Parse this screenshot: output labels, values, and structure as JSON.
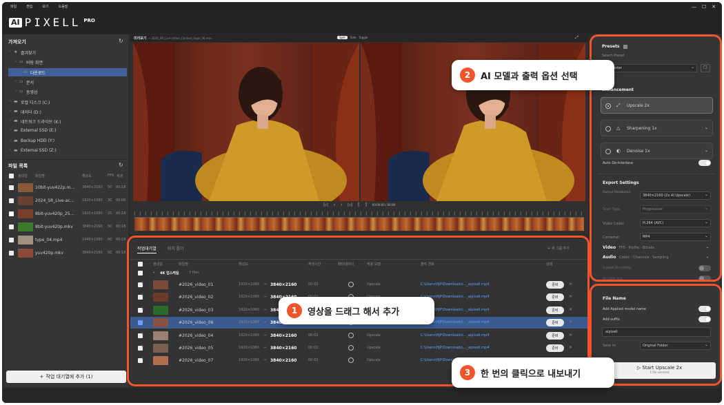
{
  "app": {
    "logo_text": "PIXELL",
    "logo_sub": "PRO",
    "menu": [
      "파일",
      "편집",
      "보기",
      "도움말"
    ]
  },
  "window_controls": [
    "—",
    "☐",
    "✕"
  ],
  "import_panel": {
    "title": "가져오기",
    "tree": [
      {
        "label": "즐겨찾기",
        "level": 0,
        "icon": "star-icon"
      },
      {
        "label": "바탕 화면",
        "level": 1,
        "icon": "folder-icon"
      },
      {
        "label": "다운로드",
        "level": 1,
        "icon": "folder-icon",
        "selected": true
      },
      {
        "label": "문서",
        "level": 1,
        "icon": "folder-icon"
      },
      {
        "label": "동영상",
        "level": 1,
        "icon": "folder-icon"
      },
      {
        "label": "로컬 디스크 (C:)",
        "level": 0,
        "icon": "drive-icon"
      },
      {
        "label": "데이터 (D:)",
        "level": 0,
        "icon": "drive-icon"
      },
      {
        "label": "네트워크 드라이브 (K:)",
        "level": 0,
        "icon": "drive-icon"
      },
      {
        "label": "External SSD (E:)",
        "level": 0,
        "icon": "drive-icon"
      },
      {
        "label": "Backup HDD (Y:)",
        "level": 0,
        "icon": "drive-icon"
      },
      {
        "label": "External SSD (Z:)",
        "level": 0,
        "icon": "drive-icon"
      }
    ]
  },
  "file_list": {
    "title": "파일 목록",
    "columns": [
      "썸네일",
      "파일명",
      "해상도",
      "FPS",
      "재생"
    ],
    "files": [
      {
        "name": "10bit-yuv422p.m...",
        "res": "3840×2160",
        "fps": "50",
        "dur": "00:18",
        "thumb": "#8a5a3a"
      },
      {
        "name": "2024_SR_Live-ac...",
        "res": "1920×1080",
        "fps": "30",
        "dur": "00:00",
        "thumb": "#6a4030"
      },
      {
        "name": "8bit-yuv420p_25...",
        "res": "1920×1080",
        "fps": "25",
        "dur": "00:18",
        "thumb": "#7a3f2a"
      },
      {
        "name": "8bit-yuv420p.mkv",
        "res": "3840×2160",
        "fps": "50",
        "dur": "00:18",
        "thumb": "#3a7a2a"
      },
      {
        "name": "type_04.mp4",
        "res": "1440×1080",
        "fps": "60",
        "dur": "00:18",
        "thumb": "#a09080"
      },
      {
        "name": "yuv420p.mkv",
        "res": "3840×2160",
        "fps": "50",
        "dur": "00:18",
        "thumb": "#8a4a3a"
      }
    ],
    "add_button": "작업 대기열에 추가 (1)"
  },
  "preview": {
    "title": "미리보기",
    "filename": "~ 2024_SR_Live action_Contest_Suga_06.mov",
    "modes": [
      "Split",
      "Side",
      "Toggle"
    ],
    "timecode": "00:00:00 / 00:00"
  },
  "queue": {
    "tabs": [
      "작업대기열",
      "워치 폴더"
    ],
    "add_group": "+ 새 그룹 추가",
    "columns": [
      "썸네일",
      "파일명",
      "해상도",
      "재생시간",
      "메타데이터",
      "적용 모델",
      "출력 경로",
      "상태"
    ],
    "group": {
      "name": "4K 업스케일",
      "count": "7 files"
    },
    "items": [
      {
        "name": "#2026_video_01",
        "src": "1920×1080",
        "dst": "3840×2160",
        "dur": "00:02",
        "model": "Upscale",
        "path": "C:\\Users\\HJP\\Downloads\\..._aipixell.mp4",
        "status": "준비",
        "thumb": "#7a4a3a",
        "selected": false
      },
      {
        "name": "#2026_video_02",
        "src": "1920×1080",
        "dst": "3840×2160",
        "dur": "00:02",
        "model": "Upscale",
        "path": "C:\\Users\\HJP\\Downloads\\..._aipixell.mp4",
        "status": "준비",
        "thumb": "#6a3a2a",
        "selected": false
      },
      {
        "name": "#2026_video_03",
        "src": "1920×1080",
        "dst": "3840×2160",
        "dur": "00:02",
        "model": "Upscale",
        "path": "C:\\Users\\HJP\\Downloads\\..._aipixell.mp4",
        "status": "준비",
        "thumb": "#2a6a2a",
        "selected": false
      },
      {
        "name": "#2026_video_06",
        "src": "1920×1080",
        "dst": "3840×2160",
        "dur": "00:02",
        "model": "Upscale",
        "path": "C:\\Users\\HJP\\Downloads\\..._aipixell.mp4",
        "status": "준비",
        "thumb": "#8a5040",
        "selected": true
      },
      {
        "name": "#2026_video_04",
        "src": "1920×1080",
        "dst": "3840×2160",
        "dur": "00:02",
        "model": "Upscale",
        "path": "C:\\Users\\HJP\\Downloads\\..._aipixell.mp4",
        "status": "준비",
        "thumb": "#9a8070",
        "selected": false
      },
      {
        "name": "#2026_video_05",
        "src": "1920×1080",
        "dst": "3840×2160",
        "dur": "00:02",
        "model": "Upscale",
        "path": "C:\\Users\\HJP\\Downloads\\..._aipixell.mp4",
        "status": "준비",
        "thumb": "#7a6050",
        "selected": false
      },
      {
        "name": "#2026_video_07",
        "src": "1920×1080",
        "dst": "3840×2160",
        "dur": "00:02",
        "model": "Upscale",
        "path": "C:\\Users\\HJP\\Downloads\\..._aipixell.mp4",
        "status": "",
        "thumb": "#b07050",
        "selected": false
      }
    ]
  },
  "settings": {
    "presets_title": "Presets",
    "select_preset": "Select Preset",
    "preset_value": "aster",
    "enhancement_title": "Enhancement",
    "models": [
      {
        "label": "Upscale 2x",
        "icon": "upscale-icon",
        "checked": true
      },
      {
        "label": "Sharpening 1x",
        "icon": "sharpen-icon",
        "checked": false
      },
      {
        "label": "Denoise 1x",
        "icon": "denoise-icon",
        "checked": false
      }
    ],
    "auto_deinterlace": "Auto De-Interlace",
    "export_title": "Export Settings",
    "output_res_label": "Output Resolution",
    "output_res_value": "3840×2160 (2x AI Upscale)",
    "scan_type_label": "Scan Type",
    "scan_type_value": "Progressive",
    "video_codec_label": "Video Codec",
    "video_codec_value": "H.264 (AVC)",
    "container_label": "Container",
    "container_value": "MP4",
    "video_label": "Video",
    "video_sub": "FPS · Profile · Bitrate",
    "audio_label": "Audio",
    "audio_sub": "Codec · Channels · Sampling",
    "two_pass": "2-pass Encoding",
    "hw_accel": "하드웨어 가속",
    "file_name_title": "File Name",
    "add_model_name": "Add Applied model name",
    "add_suffix": "Add suffix",
    "suffix_value": "aipixell",
    "save_to_label": "Save to",
    "save_to_value": "Original Folder",
    "start_button": "Start Upscale 2x",
    "start_sub": "1 file selected"
  },
  "callouts": [
    {
      "num": "1",
      "text": "영상을 드래그 해서 추가"
    },
    {
      "num": "2",
      "text": "AI 모델과 출력 옵션 선택"
    },
    {
      "num": "3",
      "text": "한 번의 클릭으로 내보내기"
    }
  ],
  "colors": {
    "accent": "#f2552c",
    "selected_row": "#3a5a90",
    "link": "#5aa0ff",
    "bg": "#2c2c2c"
  }
}
